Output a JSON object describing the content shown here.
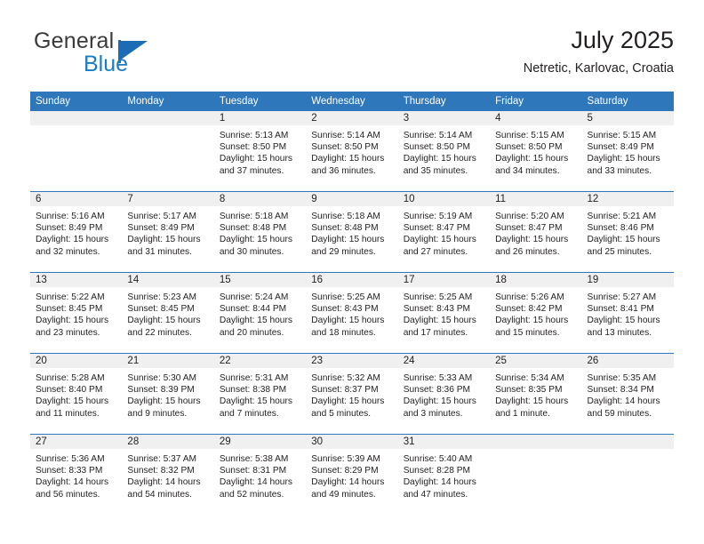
{
  "brand": {
    "name_part1": "General",
    "name_part2": "Blue",
    "flag_icon": "flag-triangle-icon",
    "accent_color": "#1b7cc4"
  },
  "header": {
    "title": "July 2025",
    "location": "Netretic, Karlovac, Croatia"
  },
  "colors": {
    "header_blue": "#2e77bb",
    "daynum_band": "#f0f0f0",
    "text": "#231f20"
  },
  "weekdays": [
    "Sunday",
    "Monday",
    "Tuesday",
    "Wednesday",
    "Thursday",
    "Friday",
    "Saturday"
  ],
  "weeks": [
    [
      {
        "day": "",
        "sunrise": "",
        "sunset": "",
        "daylight1": "",
        "daylight2": ""
      },
      {
        "day": "",
        "sunrise": "",
        "sunset": "",
        "daylight1": "",
        "daylight2": ""
      },
      {
        "day": "1",
        "sunrise": "Sunrise: 5:13 AM",
        "sunset": "Sunset: 8:50 PM",
        "daylight1": "Daylight: 15 hours",
        "daylight2": "and 37 minutes."
      },
      {
        "day": "2",
        "sunrise": "Sunrise: 5:14 AM",
        "sunset": "Sunset: 8:50 PM",
        "daylight1": "Daylight: 15 hours",
        "daylight2": "and 36 minutes."
      },
      {
        "day": "3",
        "sunrise": "Sunrise: 5:14 AM",
        "sunset": "Sunset: 8:50 PM",
        "daylight1": "Daylight: 15 hours",
        "daylight2": "and 35 minutes."
      },
      {
        "day": "4",
        "sunrise": "Sunrise: 5:15 AM",
        "sunset": "Sunset: 8:50 PM",
        "daylight1": "Daylight: 15 hours",
        "daylight2": "and 34 minutes."
      },
      {
        "day": "5",
        "sunrise": "Sunrise: 5:15 AM",
        "sunset": "Sunset: 8:49 PM",
        "daylight1": "Daylight: 15 hours",
        "daylight2": "and 33 minutes."
      }
    ],
    [
      {
        "day": "6",
        "sunrise": "Sunrise: 5:16 AM",
        "sunset": "Sunset: 8:49 PM",
        "daylight1": "Daylight: 15 hours",
        "daylight2": "and 32 minutes."
      },
      {
        "day": "7",
        "sunrise": "Sunrise: 5:17 AM",
        "sunset": "Sunset: 8:49 PM",
        "daylight1": "Daylight: 15 hours",
        "daylight2": "and 31 minutes."
      },
      {
        "day": "8",
        "sunrise": "Sunrise: 5:18 AM",
        "sunset": "Sunset: 8:48 PM",
        "daylight1": "Daylight: 15 hours",
        "daylight2": "and 30 minutes."
      },
      {
        "day": "9",
        "sunrise": "Sunrise: 5:18 AM",
        "sunset": "Sunset: 8:48 PM",
        "daylight1": "Daylight: 15 hours",
        "daylight2": "and 29 minutes."
      },
      {
        "day": "10",
        "sunrise": "Sunrise: 5:19 AM",
        "sunset": "Sunset: 8:47 PM",
        "daylight1": "Daylight: 15 hours",
        "daylight2": "and 27 minutes."
      },
      {
        "day": "11",
        "sunrise": "Sunrise: 5:20 AM",
        "sunset": "Sunset: 8:47 PM",
        "daylight1": "Daylight: 15 hours",
        "daylight2": "and 26 minutes."
      },
      {
        "day": "12",
        "sunrise": "Sunrise: 5:21 AM",
        "sunset": "Sunset: 8:46 PM",
        "daylight1": "Daylight: 15 hours",
        "daylight2": "and 25 minutes."
      }
    ],
    [
      {
        "day": "13",
        "sunrise": "Sunrise: 5:22 AM",
        "sunset": "Sunset: 8:45 PM",
        "daylight1": "Daylight: 15 hours",
        "daylight2": "and 23 minutes."
      },
      {
        "day": "14",
        "sunrise": "Sunrise: 5:23 AM",
        "sunset": "Sunset: 8:45 PM",
        "daylight1": "Daylight: 15 hours",
        "daylight2": "and 22 minutes."
      },
      {
        "day": "15",
        "sunrise": "Sunrise: 5:24 AM",
        "sunset": "Sunset: 8:44 PM",
        "daylight1": "Daylight: 15 hours",
        "daylight2": "and 20 minutes."
      },
      {
        "day": "16",
        "sunrise": "Sunrise: 5:25 AM",
        "sunset": "Sunset: 8:43 PM",
        "daylight1": "Daylight: 15 hours",
        "daylight2": "and 18 minutes."
      },
      {
        "day": "17",
        "sunrise": "Sunrise: 5:25 AM",
        "sunset": "Sunset: 8:43 PM",
        "daylight1": "Daylight: 15 hours",
        "daylight2": "and 17 minutes."
      },
      {
        "day": "18",
        "sunrise": "Sunrise: 5:26 AM",
        "sunset": "Sunset: 8:42 PM",
        "daylight1": "Daylight: 15 hours",
        "daylight2": "and 15 minutes."
      },
      {
        "day": "19",
        "sunrise": "Sunrise: 5:27 AM",
        "sunset": "Sunset: 8:41 PM",
        "daylight1": "Daylight: 15 hours",
        "daylight2": "and 13 minutes."
      }
    ],
    [
      {
        "day": "20",
        "sunrise": "Sunrise: 5:28 AM",
        "sunset": "Sunset: 8:40 PM",
        "daylight1": "Daylight: 15 hours",
        "daylight2": "and 11 minutes."
      },
      {
        "day": "21",
        "sunrise": "Sunrise: 5:30 AM",
        "sunset": "Sunset: 8:39 PM",
        "daylight1": "Daylight: 15 hours",
        "daylight2": "and 9 minutes."
      },
      {
        "day": "22",
        "sunrise": "Sunrise: 5:31 AM",
        "sunset": "Sunset: 8:38 PM",
        "daylight1": "Daylight: 15 hours",
        "daylight2": "and 7 minutes."
      },
      {
        "day": "23",
        "sunrise": "Sunrise: 5:32 AM",
        "sunset": "Sunset: 8:37 PM",
        "daylight1": "Daylight: 15 hours",
        "daylight2": "and 5 minutes."
      },
      {
        "day": "24",
        "sunrise": "Sunrise: 5:33 AM",
        "sunset": "Sunset: 8:36 PM",
        "daylight1": "Daylight: 15 hours",
        "daylight2": "and 3 minutes."
      },
      {
        "day": "25",
        "sunrise": "Sunrise: 5:34 AM",
        "sunset": "Sunset: 8:35 PM",
        "daylight1": "Daylight: 15 hours",
        "daylight2": "and 1 minute."
      },
      {
        "day": "26",
        "sunrise": "Sunrise: 5:35 AM",
        "sunset": "Sunset: 8:34 PM",
        "daylight1": "Daylight: 14 hours",
        "daylight2": "and 59 minutes."
      }
    ],
    [
      {
        "day": "27",
        "sunrise": "Sunrise: 5:36 AM",
        "sunset": "Sunset: 8:33 PM",
        "daylight1": "Daylight: 14 hours",
        "daylight2": "and 56 minutes."
      },
      {
        "day": "28",
        "sunrise": "Sunrise: 5:37 AM",
        "sunset": "Sunset: 8:32 PM",
        "daylight1": "Daylight: 14 hours",
        "daylight2": "and 54 minutes."
      },
      {
        "day": "29",
        "sunrise": "Sunrise: 5:38 AM",
        "sunset": "Sunset: 8:31 PM",
        "daylight1": "Daylight: 14 hours",
        "daylight2": "and 52 minutes."
      },
      {
        "day": "30",
        "sunrise": "Sunrise: 5:39 AM",
        "sunset": "Sunset: 8:29 PM",
        "daylight1": "Daylight: 14 hours",
        "daylight2": "and 49 minutes."
      },
      {
        "day": "31",
        "sunrise": "Sunrise: 5:40 AM",
        "sunset": "Sunset: 8:28 PM",
        "daylight1": "Daylight: 14 hours",
        "daylight2": "and 47 minutes."
      },
      {
        "day": "",
        "sunrise": "",
        "sunset": "",
        "daylight1": "",
        "daylight2": ""
      },
      {
        "day": "",
        "sunrise": "",
        "sunset": "",
        "daylight1": "",
        "daylight2": ""
      }
    ]
  ]
}
